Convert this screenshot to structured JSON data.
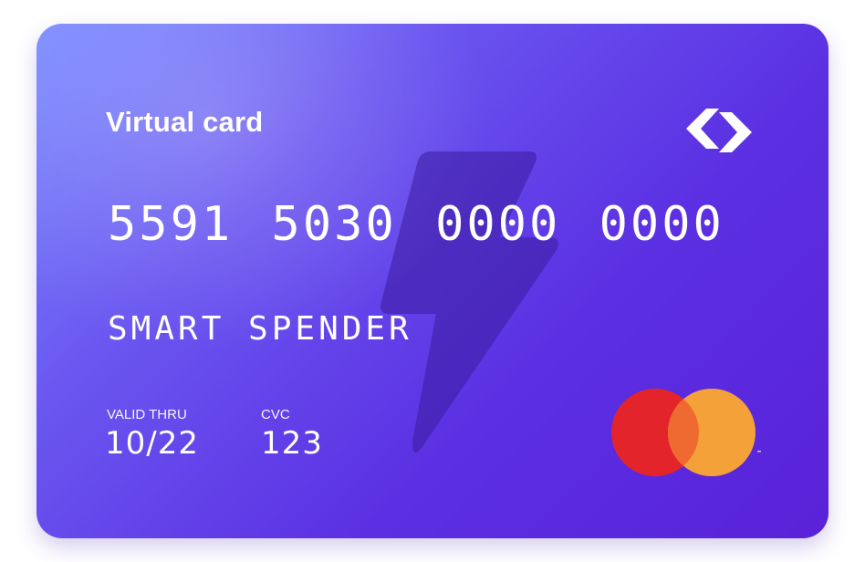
{
  "card": {
    "label": "Virtual card",
    "number": "5591 5030 0000 0000",
    "holder": "SMART SPENDER",
    "valid_thru_label": "VALID THRU",
    "valid_thru": "10/22",
    "cvc_label": "CVC",
    "cvc": "123"
  },
  "icons": {
    "brand": "chevrons-logo-icon",
    "watermark": "lightning-bolt-icon",
    "network": "mastercard-logo-icon"
  },
  "colors": {
    "gradient_start": "#7b8cff",
    "gradient_end": "#5a22d8",
    "network_red": "#e3242b",
    "network_orange": "#f4a13a",
    "network_overlap": "#ef6a30"
  }
}
